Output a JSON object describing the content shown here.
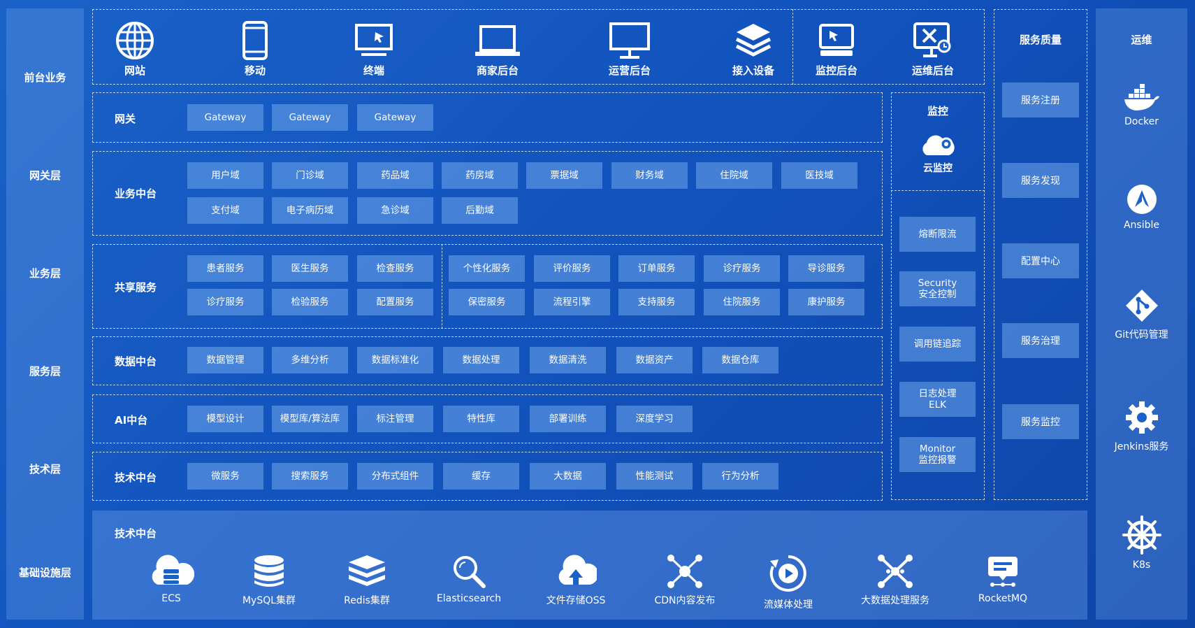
{
  "layers": [
    "前台业务",
    "网关层",
    "业务层",
    "服务层",
    "技术层",
    "基础设施层"
  ],
  "frontend": [
    "网站",
    "移动",
    "终端",
    "商家后台",
    "运营后台",
    "接入设备",
    "监控后台",
    "运维后台"
  ],
  "gateway": {
    "label": "网关",
    "items": [
      "Gateway",
      "Gateway",
      "Gateway"
    ]
  },
  "business": {
    "label": "业务中台",
    "row1": [
      "用户域",
      "门诊域",
      "药品域",
      "药房域",
      "票据域",
      "财务域",
      "住院域",
      "医技域"
    ],
    "row2": [
      "支付域",
      "电子病历域",
      "急诊域",
      "后勤域"
    ]
  },
  "shared": {
    "label": "共享服务",
    "left1": [
      "患者服务",
      "医生服务",
      "检查服务"
    ],
    "left2": [
      "诊疗服务",
      "检验服务",
      "配置服务"
    ],
    "right1": [
      "个性化服务",
      "评价服务",
      "订单服务",
      "诊疗服务",
      "导诊服务"
    ],
    "right2": [
      "保密服务",
      "流程引擎",
      "支持服务",
      "住院服务",
      "康护服务"
    ]
  },
  "data": {
    "label": "数据中台",
    "items": [
      "数据管理",
      "多维分析",
      "数据标准化",
      "数据处理",
      "数据清洗",
      "数据资产",
      "数据仓库"
    ]
  },
  "ai": {
    "label": "AI中台",
    "items": [
      "模型设计",
      "模型库/算法库",
      "标注管理",
      "特性库",
      "部署训练",
      "深度学习"
    ]
  },
  "tech": {
    "label": "技术中台",
    "items": [
      "微服务",
      "搜索服务",
      "分布式组件",
      "缓存",
      "大数据",
      "性能测试",
      "行为分析"
    ]
  },
  "monitor": {
    "title": "监控",
    "cloud": "云监控",
    "items": [
      "熔断限流",
      "Security\n安全控制",
      "调用链追踪",
      "日志处理\nELK",
      "Monitor\n监控报警"
    ]
  },
  "quality": {
    "title": "服务质量",
    "items": [
      "服务注册",
      "服务发现",
      "配置中心",
      "服务治理",
      "服务监控"
    ]
  },
  "ops": {
    "title": "运维",
    "items": [
      "Docker",
      "Ansible",
      "Git代码管理",
      "Jenkins服务",
      "K8s"
    ]
  },
  "infra": {
    "label": "技术中台",
    "items": [
      "ECS",
      "MySQL集群",
      "Redis集群",
      "Elasticsearch",
      "文件存储OSS",
      "CDN内容发布",
      "流媒体处理",
      "大数据处理服务",
      "RocketMQ"
    ]
  }
}
